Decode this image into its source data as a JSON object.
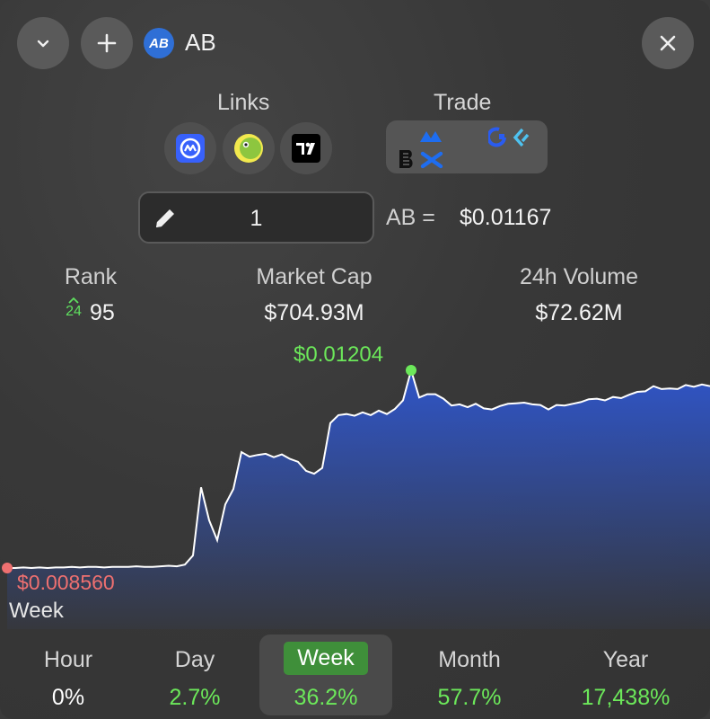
{
  "header": {
    "token_symbol": "AB",
    "logo_text": "AB",
    "collapse_icon": "chevron-down-icon",
    "add_icon": "plus-icon",
    "close_icon": "close-icon"
  },
  "links": {
    "label": "Links",
    "items": [
      {
        "name": "coinmarketcap-icon",
        "color": "#3861fb"
      },
      {
        "name": "coingecko-icon",
        "color": "#8dc63f"
      },
      {
        "name": "tradingview-icon",
        "color": "#000000"
      }
    ]
  },
  "trade": {
    "label": "Trade",
    "icons": [
      "exchange-icon-1",
      "exchange-icon-2",
      "exchange-icon-3",
      "exchange-icon-4"
    ]
  },
  "converter": {
    "amount": "1",
    "symbol_eq": "AB =",
    "price": "$0.01167"
  },
  "stats": {
    "rank_label": "Rank",
    "rank_change": "24",
    "rank_value": "95",
    "market_cap_label": "Market Cap",
    "market_cap_value": "$704.93M",
    "volume_label": "24h Volume",
    "volume_value": "$72.62M"
  },
  "chart_data": {
    "type": "area",
    "high_label": "$0.01204",
    "low_label": "$0.008560",
    "range_label": "Week",
    "y_high": 0.01204,
    "y_low": 0.00856,
    "values": [
      0.00856,
      0.00856,
      0.00857,
      0.00856,
      0.00857,
      0.00856,
      0.00857,
      0.00857,
      0.00858,
      0.00857,
      0.00858,
      0.00858,
      0.00857,
      0.00858,
      0.00858,
      0.00858,
      0.00859,
      0.00858,
      0.00858,
      0.00859,
      0.0086,
      0.00859,
      0.00862,
      0.00878,
      0.00998,
      0.0094,
      0.00905,
      0.00968,
      0.00995,
      0.0106,
      0.01052,
      0.01055,
      0.01057,
      0.01051,
      0.01056,
      0.01048,
      0.01043,
      0.01027,
      0.01022,
      0.01032,
      0.01111,
      0.01125,
      0.01127,
      0.01124,
      0.0113,
      0.01125,
      0.01133,
      0.01127,
      0.01136,
      0.01151,
      0.01204,
      0.01156,
      0.01162,
      0.01162,
      0.01154,
      0.01142,
      0.01144,
      0.01139,
      0.01145,
      0.01137,
      0.01135,
      0.01141,
      0.01145,
      0.01146,
      0.01147,
      0.01144,
      0.01143,
      0.01135,
      0.01143,
      0.01142,
      0.01145,
      0.01148,
      0.01153,
      0.01154,
      0.01151,
      0.01157,
      0.01155,
      0.01161,
      0.01166,
      0.01167,
      0.01176,
      0.01171,
      0.01172,
      0.01171,
      0.01178,
      0.01175,
      0.01179,
      0.01176
    ],
    "line_color": "#ffffff",
    "fill_color": "#2f55c8",
    "high_color": "#6ce85a",
    "low_color": "#ef7070"
  },
  "periods": [
    {
      "name": "Hour",
      "change": "0%",
      "color": "#ffffff",
      "active": false
    },
    {
      "name": "Day",
      "change": "2.7%",
      "color": "#6ce85a",
      "active": false
    },
    {
      "name": "Week",
      "change": "36.2%",
      "color": "#6ce85a",
      "active": true
    },
    {
      "name": "Month",
      "change": "57.7%",
      "color": "#6ce85a",
      "active": false
    },
    {
      "name": "Year",
      "change": "17,438%",
      "color": "#6ce85a",
      "active": false
    }
  ]
}
